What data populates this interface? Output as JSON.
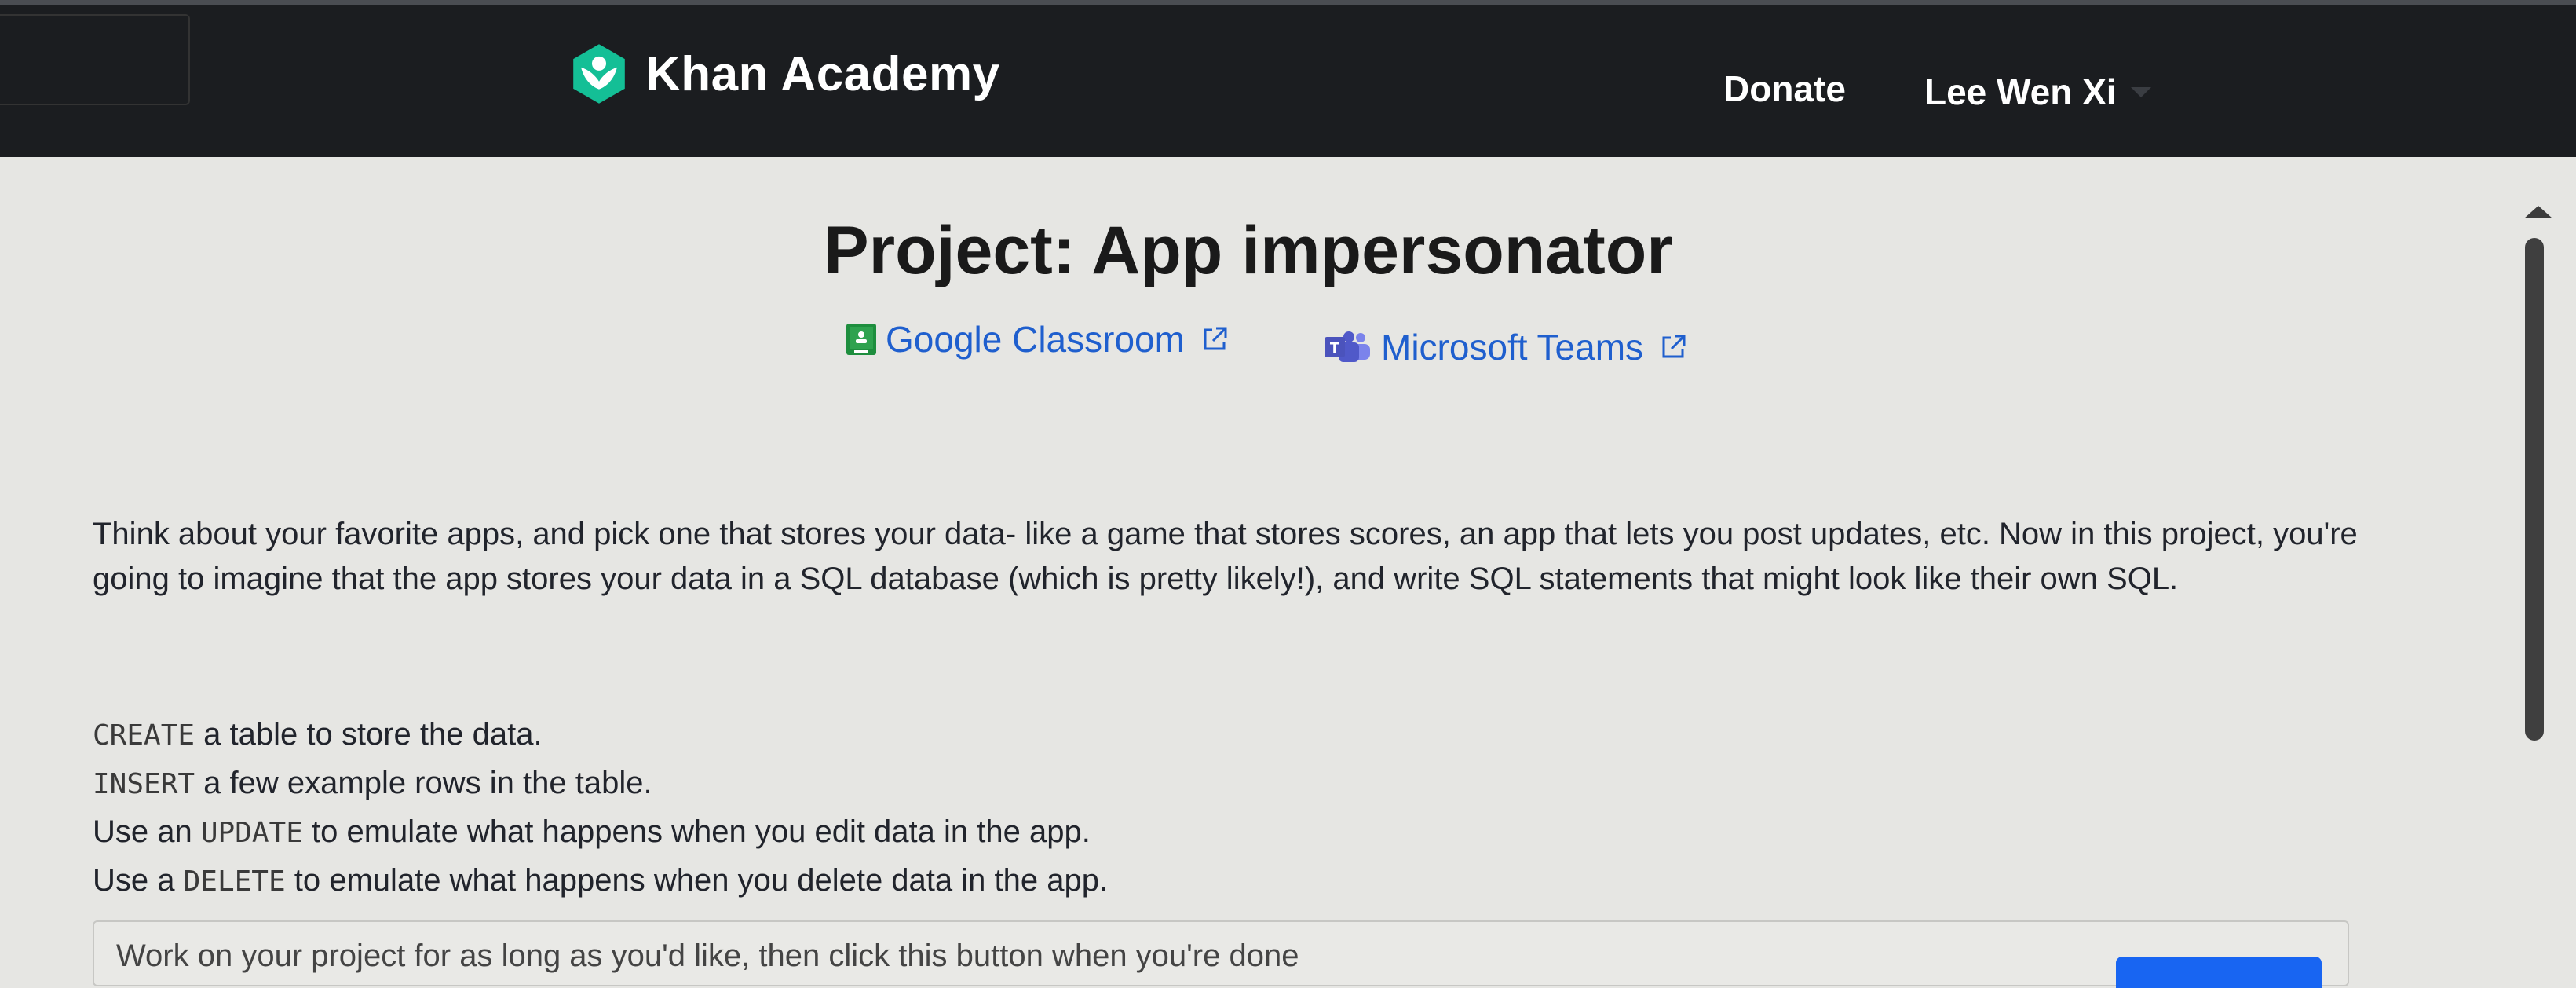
{
  "header": {
    "logo_text": "Khan Academy",
    "donate": "Donate",
    "user_name": "Lee Wen Xi"
  },
  "page": {
    "title": "Project: App impersonator",
    "share": {
      "google_classroom": "Google Classroom",
      "microsoft_teams": "Microsoft Teams"
    }
  },
  "content": {
    "description": "Think about your favorite apps, and pick one that stores your data- like a game that stores scores, an app that lets you post updates, etc. Now in this project, you're going to imagine that the app stores your data in a SQL database (which is pretty likely!), and write SQL statements that might look like their own SQL.",
    "steps": [
      {
        "pre": "",
        "code": "CREATE",
        "post": " a table to store the data."
      },
      {
        "pre": "",
        "code": "INSERT",
        "post": " a few example rows in the table."
      },
      {
        "pre": "Use an ",
        "code": "UPDATE",
        "post": " to emulate what happens when you edit data in the app."
      },
      {
        "pre": "Use a ",
        "code": "DELETE",
        "post": " to emulate what happens when you delete data in the app."
      }
    ],
    "done_prompt": "Work on your project for as long as you'd like, then click this button when you're done"
  },
  "colors": {
    "nav_bg": "#1b1d20",
    "page_bg": "#e6e6e3",
    "link": "#1f5fce",
    "logo_green": "#14bf96",
    "button_blue": "#1865f2"
  },
  "icons": {
    "logo": "khan-academy-leaf-icon",
    "google_classroom": "google-classroom-icon",
    "microsoft_teams": "microsoft-teams-icon",
    "external": "external-link-icon",
    "user_menu": "chevron-down-icon"
  }
}
